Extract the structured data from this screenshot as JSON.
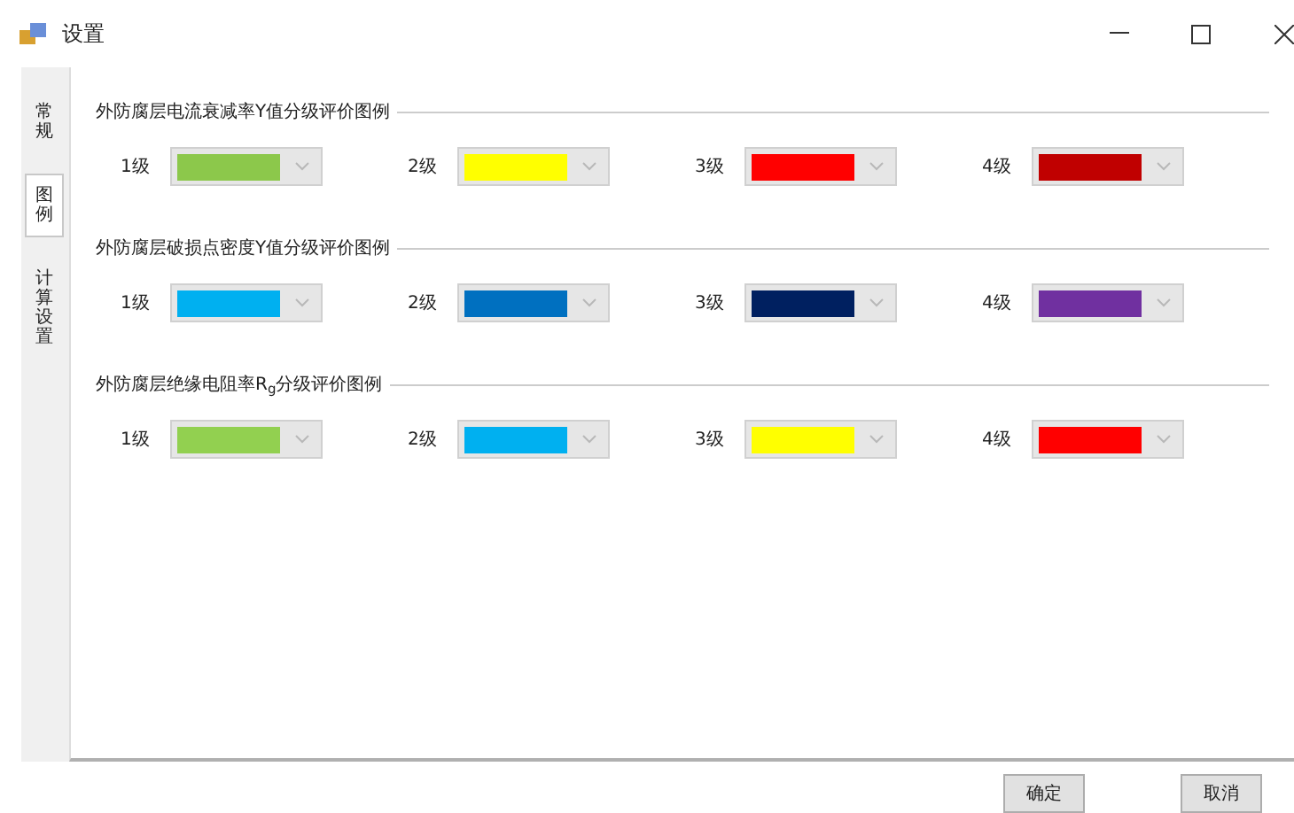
{
  "window": {
    "title": "设置"
  },
  "tabs": [
    {
      "label": "常规",
      "selected": false
    },
    {
      "label": "图例",
      "selected": true
    },
    {
      "label": "计算设置",
      "selected": false
    }
  ],
  "groups": [
    {
      "title": "外防腐层电流衰减率Y值分级评价图例",
      "levels": [
        {
          "label": "1级",
          "color": "#8cc84b"
        },
        {
          "label": "2级",
          "color": "#ffff00"
        },
        {
          "label": "3级",
          "color": "#ff0000"
        },
        {
          "label": "4级",
          "color": "#c00000"
        }
      ]
    },
    {
      "title": "外防腐层破损点密度Y值分级评价图例",
      "levels": [
        {
          "label": "1级",
          "color": "#00b0f0"
        },
        {
          "label": "2级",
          "color": "#0070c0"
        },
        {
          "label": "3级",
          "color": "#002060"
        },
        {
          "label": "4级",
          "color": "#7030a0"
        }
      ]
    },
    {
      "title": "外防腐层绝缘电阻率R$_{g}$分级评价图例",
      "levels": [
        {
          "label": "1级",
          "color": "#92d050"
        },
        {
          "label": "2级",
          "color": "#00b0f0"
        },
        {
          "label": "3级",
          "color": "#ffff00"
        },
        {
          "label": "4级",
          "color": "#ff0000"
        }
      ]
    }
  ],
  "buttons": [
    "确定",
    "取消"
  ]
}
